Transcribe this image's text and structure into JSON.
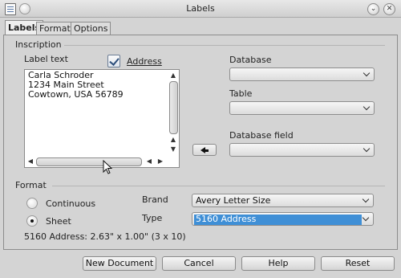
{
  "window": {
    "title": "Labels"
  },
  "tabs": [
    {
      "label": "Labels",
      "underline": "L"
    },
    {
      "label": "Format",
      "underline": "F"
    },
    {
      "label": "Options",
      "underline": "O"
    }
  ],
  "inscription": {
    "group_label": "Inscription",
    "label_text_label": "Label text",
    "address_checkbox": {
      "label": "Address",
      "checked": true
    },
    "label_text_value": "Carla Schroder\n1234 Main Street\nCowtown, USA 56789"
  },
  "database": {
    "database_label": "Database",
    "database_value": "",
    "table_label": "Table",
    "table_value": "",
    "field_label": "Database field",
    "field_value": ""
  },
  "format": {
    "group_label": "Format",
    "continuous_label": "Continuous",
    "sheet_label": "Sheet",
    "selected": "Sheet",
    "brand_label": "Brand",
    "brand_value": "Avery Letter Size",
    "type_label": "Type",
    "type_value": "5160 Address",
    "summary": "5160 Address: 2.63\" x 1.00\" (3 x 10)"
  },
  "buttons": {
    "new_document": "New Document",
    "cancel": "Cancel",
    "help": "Help",
    "reset": "Reset"
  },
  "icons": {
    "app": "document-icon",
    "pin": "pin-icon",
    "minimize": "minimize-icon",
    "close": "close-icon",
    "insert_field": "arrow-left-icon"
  }
}
